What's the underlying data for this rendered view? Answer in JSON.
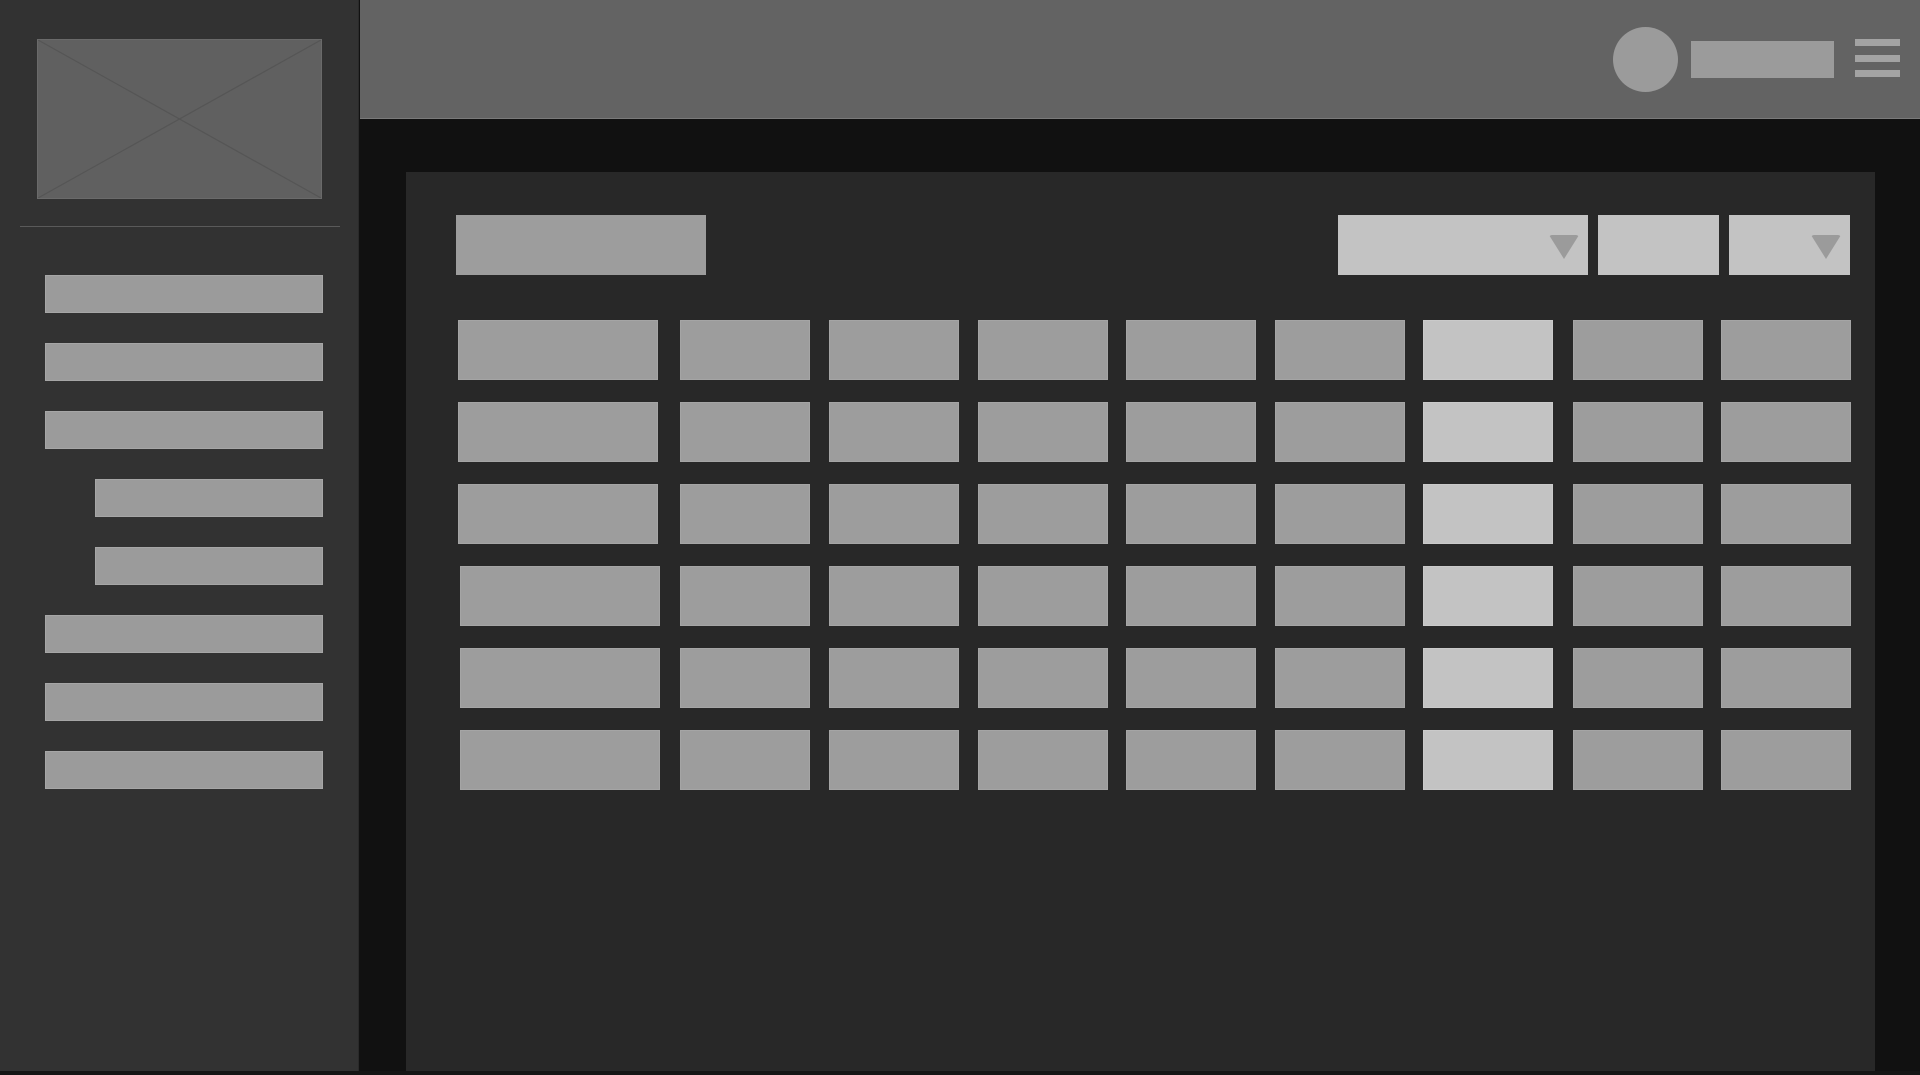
{
  "app": {
    "title": ""
  },
  "sidebar": {
    "logo_icon": "image-placeholder-icon",
    "items": [
      {
        "label": "",
        "level": 0
      },
      {
        "label": "",
        "level": 0
      },
      {
        "label": "",
        "level": 0
      },
      {
        "label": "",
        "level": 1
      },
      {
        "label": "",
        "level": 1
      },
      {
        "label": "",
        "level": 0
      },
      {
        "label": "",
        "level": 0
      },
      {
        "label": "",
        "level": 0
      }
    ]
  },
  "header": {
    "avatar_icon": "user-avatar-icon",
    "user_name": "",
    "menu_icon": "hamburger-menu-icon"
  },
  "main": {
    "title": "",
    "controls": {
      "filter_select_value": "",
      "action_label": "",
      "options_select_value": "",
      "caret_icon": "chevron-down-icon"
    },
    "table": {
      "highlighted_column": 6,
      "rows": [
        [
          "",
          "",
          "",
          "",
          "",
          "",
          "",
          "",
          ""
        ],
        [
          "",
          "",
          "",
          "",
          "",
          "",
          "",
          "",
          ""
        ],
        [
          "",
          "",
          "",
          "",
          "",
          "",
          "",
          "",
          ""
        ],
        [
          "",
          "",
          "",
          "",
          "",
          "",
          "",
          "",
          ""
        ],
        [
          "",
          "",
          "",
          "",
          "",
          "",
          "",
          "",
          ""
        ],
        [
          "",
          "",
          "",
          "",
          "",
          "",
          "",
          "",
          ""
        ]
      ]
    }
  },
  "colors": {
    "background": "#111111",
    "sidebar": "#323232",
    "header": "#636363",
    "panel": "#282828",
    "placeholder": "#9d9d9d",
    "placeholder_highlight": "#c3c3c3"
  }
}
